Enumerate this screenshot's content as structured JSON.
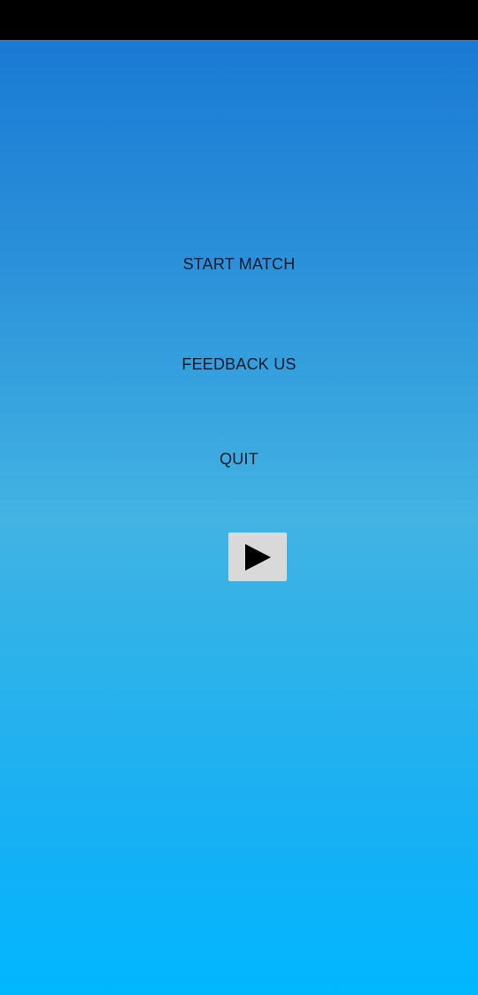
{
  "menu": {
    "start_label": "START MATCH",
    "feedback_label": "FEEDBACK US",
    "quit_label": "QUIT"
  },
  "controls": {
    "play_icon": "play-icon"
  },
  "colors": {
    "status_bar": "#000000",
    "gradient_top": "#1776d3",
    "gradient_mid": "#42b3e3",
    "gradient_bottom": "#00b7ff",
    "menu_text": "#0f1b2b",
    "play_button_bg": "#d9d9d9"
  }
}
